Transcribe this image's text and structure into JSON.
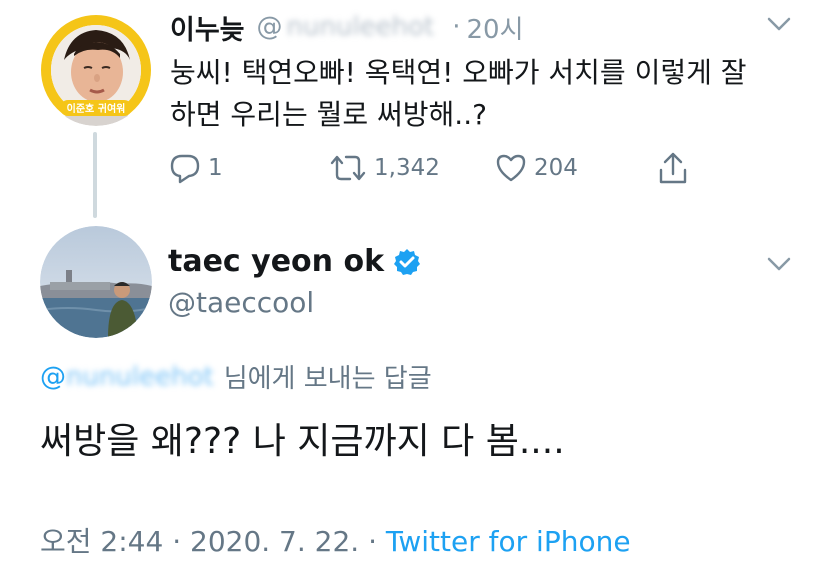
{
  "reply_to_tweet": {
    "display_name": "이누늦",
    "handle_at": "@",
    "handle_blurred": "nunuleehot",
    "separator": "·",
    "time_ago": "20시",
    "text_line1": "눙씨! 택연오빠! 옥택연! 오빠가 서치를 이렇게 잘",
    "text_line2": "하면 우리는 뭘로 써방해..?",
    "replies": "1",
    "retweets": "1,342",
    "likes": "204",
    "avatar_badge_text": "이준호 귀여워"
  },
  "main_tweet": {
    "display_name": "taec yeon ok",
    "verified": true,
    "handle": "@taeccool",
    "replying_at": "@",
    "replying_handle_blurred": "nunuleehot",
    "replying_suffix": "님에게 보내는 답글",
    "text": "써방을 왜??? 나 지금까지 다 봄....",
    "timestamp": "오전 2:44 · 2020. 7. 22. · ",
    "source": "Twitter for iPhone"
  },
  "colors": {
    "accent": "#1da1f2",
    "secondary_text": "#657786",
    "avatar_ring": "#f5c518"
  },
  "icons": [
    "reply-icon",
    "retweet-icon",
    "like-icon",
    "share-icon",
    "chevron-down-icon",
    "verified-badge-icon"
  ]
}
